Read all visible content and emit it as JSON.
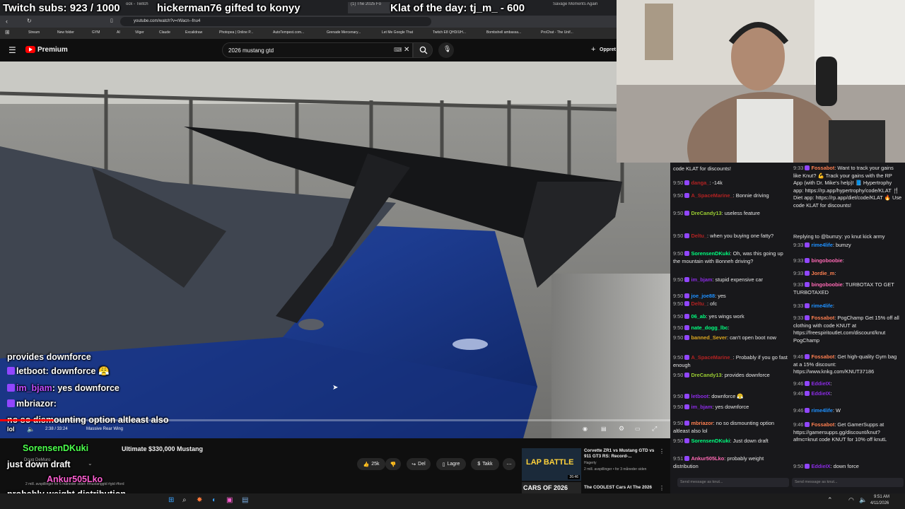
{
  "overlay": {
    "subs": "Twitch subs: 923 / 1000",
    "gift": "hickerman76 gifted to konyy",
    "klat": "Klat of the day: tj_m_ - 600"
  },
  "browser": {
    "tabs": [
      "ock - Twitch",
      "(1) The 2025 Fo",
      "Savage Moments Again"
    ],
    "url": "youtube.com/watch?v=rWacn--fnu4",
    "bookmarks": [
      "Stream",
      "New folder",
      "GYM",
      "AI",
      "Vilger",
      "Claude",
      "Excalidraw",
      "Photopea | Online P...",
      "AutoTempest.com...",
      "Grenade Mercenary...",
      "Let Me Google That",
      "Twitch E8 QHD/UH...",
      "Bombshell ambassa...",
      "ProChat - The Unif..."
    ]
  },
  "youtube": {
    "logo": "Premium",
    "search_value": "2026 mustang gtd",
    "create_label": "Oppret",
    "time": "2:38 / 33:24",
    "chapter": "Massive Rear Wing",
    "video_title": "Ultimate $330,000 Mustang",
    "channel": "Doug DeMuro",
    "likes": "25k",
    "share_label": "Del",
    "save_label": "Lagre",
    "thanks_label": "Takk",
    "description": "2 mill. avspillinger for 6 måneder siden #mustanggtd #gtd #ford"
  },
  "recommended": [
    {
      "title": "Corvette ZR1 vs Mustang GTD vs 911 GT3 RS: Record-...",
      "channel": "Hagerty",
      "meta": "2 mill. avspillinger • for 3 måneder siden",
      "duration": "26:46",
      "thumb": "LAP BATTLE"
    },
    {
      "title": "The COOLEST Cars At The 2026",
      "channel": "",
      "meta": "",
      "duration": "",
      "thumb": "CARS OF 2026"
    }
  ],
  "video_chat_overlay": [
    {
      "user": "",
      "text": "provides downforce"
    },
    {
      "user": "letboot",
      "text": ": downforce 😤"
    },
    {
      "user": "im_bjam",
      "text": ": yes downforce"
    },
    {
      "user": "mbriazor",
      "text": ":"
    },
    {
      "user": "",
      "text": "no so dismounting option altleast also"
    },
    {
      "user": "",
      "text": "lol"
    },
    {
      "user": "SorensenDKuki",
      "text": ":"
    },
    {
      "user": "",
      "text": "just down draft"
    },
    {
      "user": "Ankur505Lko",
      "text": ":"
    },
    {
      "user": "",
      "text": "probably weight distribution"
    }
  ],
  "chat_left": [
    {
      "time": "",
      "user": "",
      "text": "code KLAT for discounts!"
    },
    {
      "time": "9:50",
      "user": "danga_",
      "text": ": -14k"
    },
    {
      "time": "9:50",
      "user": "A_SpaceMarine_",
      "text": ": Bonnie driving"
    },
    {
      "time": "9:50",
      "user": "DreCandy13",
      "text": ": useless feature"
    },
    {
      "time": "9:50",
      "user": "Deltu_",
      "text": ": when you buying one fatty?"
    },
    {
      "time": "9:50",
      "user": "SorensenDKuki",
      "text": ": Oh, was this going up the mountain with Bonneh driving?"
    },
    {
      "time": "9:50",
      "user": "im_bjam",
      "text": ": stupid expensive car"
    },
    {
      "time": "9:50",
      "user": "joe_joe88",
      "text": ": yes"
    },
    {
      "time": "9:50",
      "user": "Deltu_",
      "text": ": ofc"
    },
    {
      "time": "9:50",
      "user": "06_ab",
      "text": ": yes wings work"
    },
    {
      "time": "9:50",
      "user": "nate_dogg_lbc",
      "text": ":"
    },
    {
      "time": "9:50",
      "user": "banned_Sever",
      "text": ": can't open boot now"
    },
    {
      "time": "9:50",
      "user": "A_SpaceMarine_",
      "text": ": Probably if you go fast enough"
    },
    {
      "time": "9:50",
      "user": "DreCandy13",
      "text": ": provides downforce"
    },
    {
      "time": "9:50",
      "user": "letboot",
      "text": ": downforce 😤"
    },
    {
      "time": "9:50",
      "user": "im_bjam",
      "text": ": yes downforce"
    },
    {
      "time": "9:50",
      "user": "mbriazor",
      "text": ": no so dismounting option altleast also lol"
    },
    {
      "time": "9:50",
      "user": "SorensenDKuki",
      "text": ": Just down draft"
    },
    {
      "time": "9:51",
      "user": "Ankur505Lko",
      "text": ": probably weight distribution"
    }
  ],
  "chat_right": [
    {
      "time": "9:33",
      "user": "Fossabot",
      "text": ": Want to track your gains like Knut? 💪 Track your gains with the RP App (with Dr. Mike's help)! 📘 Hypertrophy app: https://rp.app/hypertrophy/code/KLAT 🍴 Diet app: https://rp.app/diet/code/KLAT 🔥 Use code KLAT for discounts!"
    },
    {
      "time": "",
      "user": "",
      "text": "Replying to @bumzy: yo knut kick army"
    },
    {
      "time": "9:33",
      "user": "rime4life",
      "text": ": bumzy"
    },
    {
      "time": "9:33",
      "user": "bingoboobie",
      "text": ":"
    },
    {
      "time": "9:33",
      "user": "Jordie_m",
      "text": ":"
    },
    {
      "time": "9:33",
      "user": "bingoboobie",
      "text": ": TURBOTAX TO GET TURBOTAXED"
    },
    {
      "time": "9:33",
      "user": "rime4life",
      "text": ":"
    },
    {
      "time": "9:33",
      "user": "Fossabot",
      "text": ": PogChamp Get 15% off all clothing with code KNUT at https://freespiritoutlet.com/discount/knut PogChamp"
    },
    {
      "time": "9:46",
      "user": "Fossabot",
      "text": ": Get high-quality Gym bag at a 15% discount: https://www.knkg.com/KNUT37186"
    },
    {
      "time": "9:46",
      "user": "EddieIX",
      "text": ":"
    },
    {
      "time": "9:46",
      "user": "EddieIX",
      "text": ":"
    },
    {
      "time": "9:46",
      "user": "rime4life",
      "text": ": W"
    },
    {
      "time": "9:46",
      "user": "Fossabot",
      "text": ": Get GamerSupps at https://gamersupps.gg/discount/knut?afmc=knut code KNUT for 10% off knutL"
    },
    {
      "time": "9:50",
      "user": "EddieIX",
      "text": ": down force"
    }
  ],
  "chat_input_placeholder": "Send message as knut...",
  "taskbar": {
    "time": "9:51 AM",
    "date": "4/11/2026"
  },
  "colors": {
    "youtube_red": "#ff0000",
    "twitch_purple": "#9146ff",
    "chat_bg": "#18181b"
  }
}
